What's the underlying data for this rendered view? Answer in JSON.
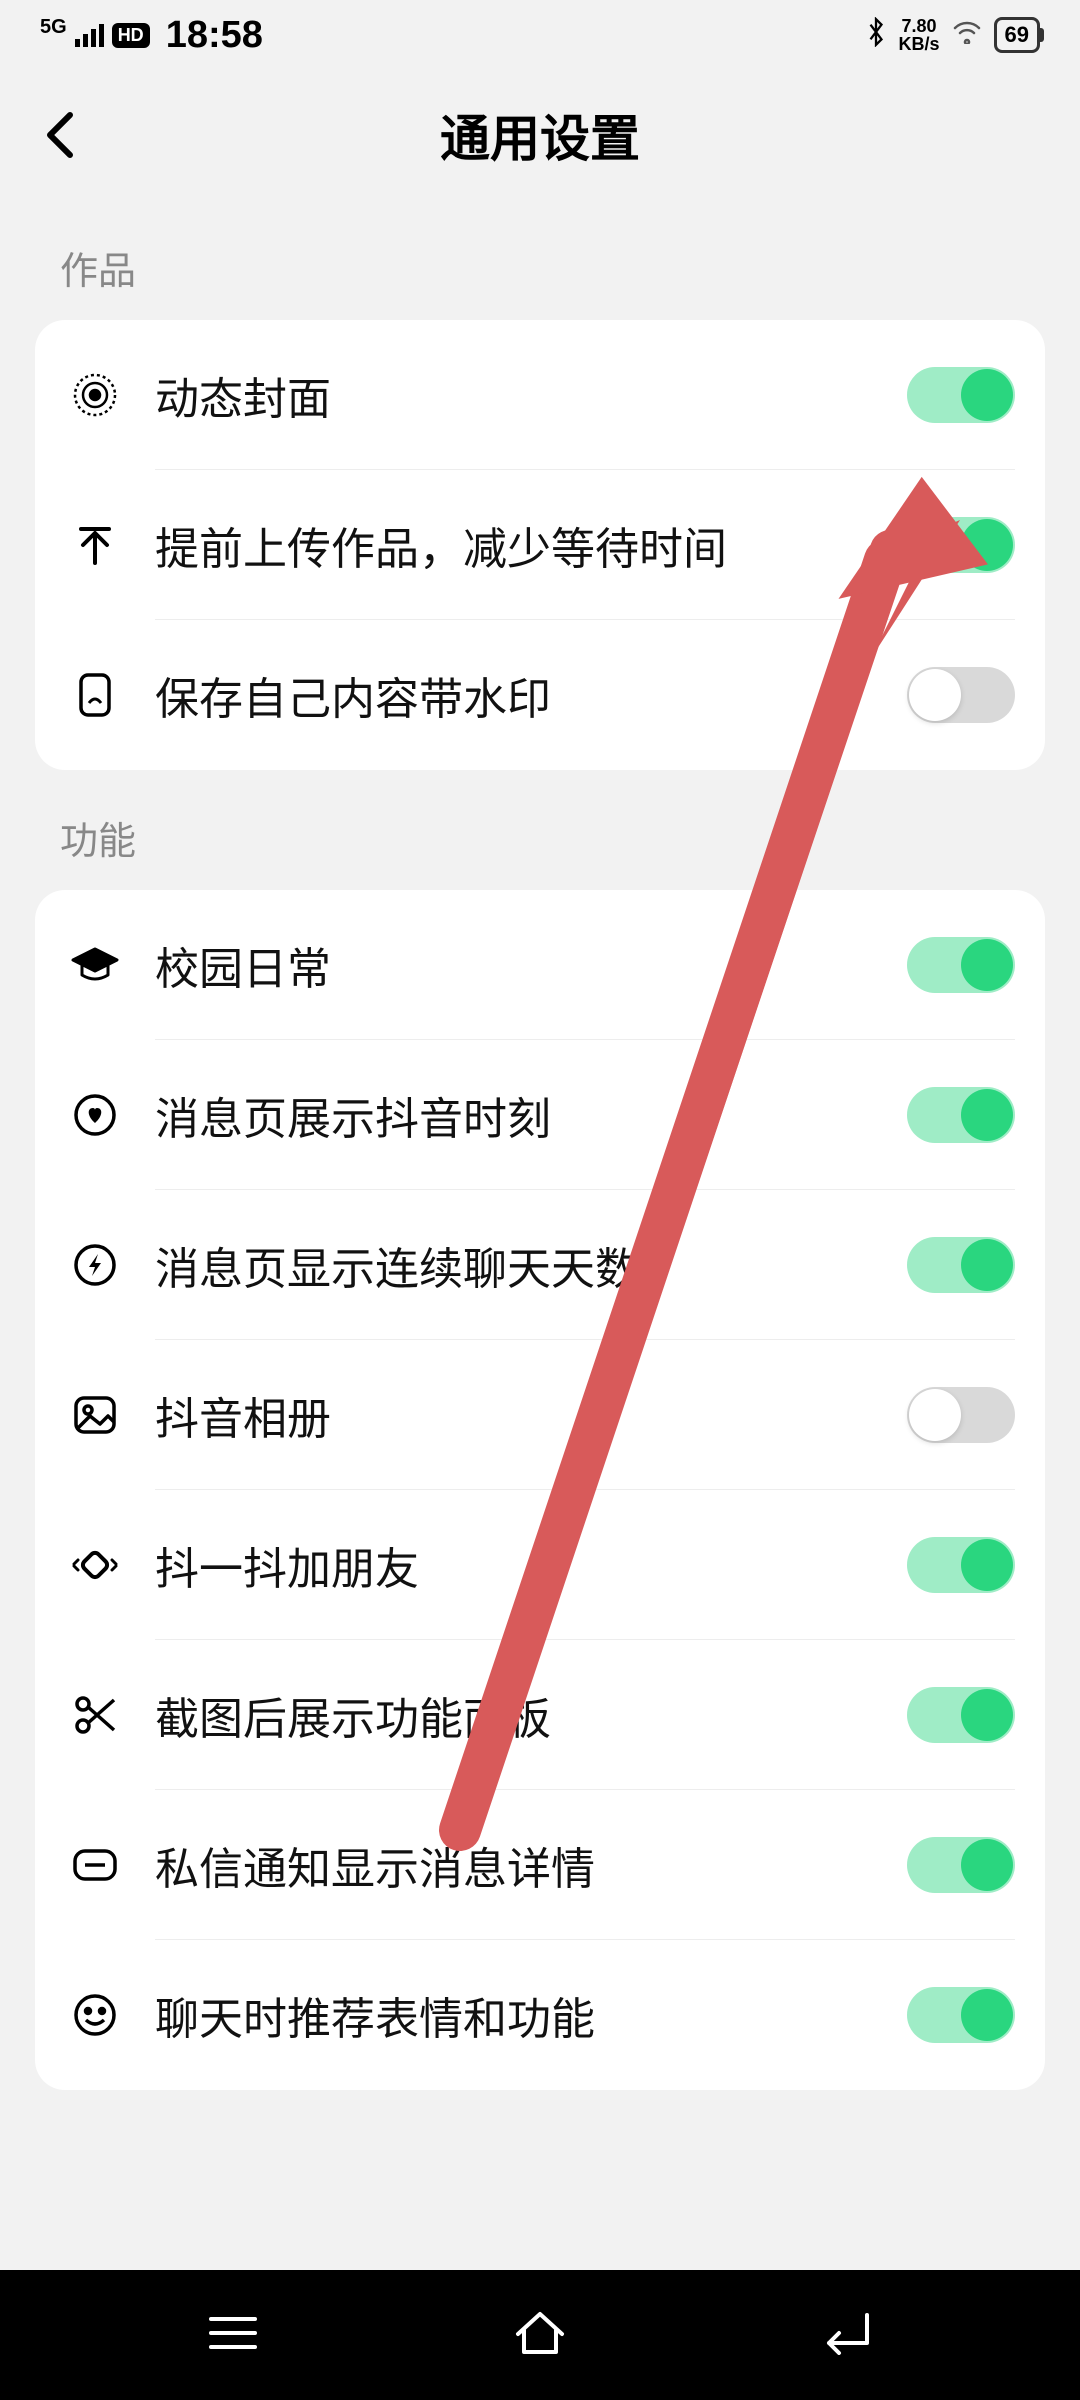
{
  "status": {
    "network": "5G",
    "hd": "HD",
    "time": "18:58",
    "speed_top": "7.80",
    "speed_bot": "KB/s",
    "battery": "69"
  },
  "header": {
    "title": "通用设置"
  },
  "sections": [
    {
      "title": "作品",
      "items": [
        {
          "icon": "bullseye-icon",
          "label": "动态封面",
          "on": true
        },
        {
          "icon": "upload-arrow-icon",
          "label": "提前上传作品，减少等待时间",
          "on": true
        },
        {
          "icon": "phone-watermark-icon",
          "label": "保存自己内容带水印",
          "on": false
        }
      ]
    },
    {
      "title": "功能",
      "items": [
        {
          "icon": "graduation-cap-icon",
          "label": "校园日常",
          "on": true
        },
        {
          "icon": "heart-circle-icon",
          "label": "消息页展示抖音时刻",
          "on": true
        },
        {
          "icon": "lightning-circle-icon",
          "label": "消息页显示连续聊天天数",
          "on": true
        },
        {
          "icon": "photo-icon",
          "label": "抖音相册",
          "on": false
        },
        {
          "icon": "shake-icon",
          "label": "抖一抖加朋友",
          "on": true
        },
        {
          "icon": "scissors-icon",
          "label": "截图后展示功能面板",
          "on": true
        },
        {
          "icon": "message-detail-icon",
          "label": "私信通知显示消息详情",
          "on": true
        },
        {
          "icon": "emoji-icon",
          "label": "聊天时推荐表情和功能",
          "on": true
        }
      ]
    }
  ],
  "colors": {
    "toggle_on_bg": "#9fecc6",
    "toggle_on_knob": "#2ad67f",
    "toggle_off_bg": "#d9d9d9",
    "arrow": "#d85a5a"
  }
}
